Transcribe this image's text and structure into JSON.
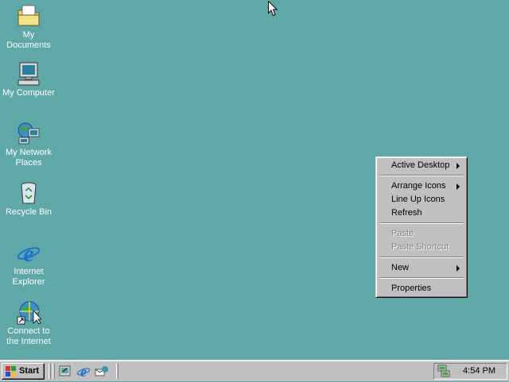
{
  "desktop": {
    "background_color": "#5fa8a8",
    "icons": [
      {
        "label_lines": [
          "My Documents"
        ],
        "icon": "folder-documents-icon"
      },
      {
        "label_lines": [
          "My Computer"
        ],
        "icon": "computer-icon"
      },
      {
        "label_lines": [
          "My Network",
          "Places"
        ],
        "icon": "network-places-icon"
      },
      {
        "label_lines": [
          "Recycle Bin"
        ],
        "icon": "recycle-bin-icon"
      },
      {
        "label_lines": [
          "Internet",
          "Explorer"
        ],
        "icon": "internet-explorer-icon"
      },
      {
        "label_lines": [
          "Connect to",
          "the Internet"
        ],
        "icon": "connect-internet-icon"
      }
    ]
  },
  "context_menu": {
    "items": {
      "active_desktop": "Active Desktop",
      "arrange_icons": "Arrange Icons",
      "line_up_icons": "Line Up Icons",
      "refresh": "Refresh",
      "paste": "Paste",
      "paste_shortcut": "Paste Shortcut",
      "new": "New",
      "properties": "Properties"
    }
  },
  "taskbar": {
    "start_label": "Start",
    "clock": "4:54 PM"
  }
}
